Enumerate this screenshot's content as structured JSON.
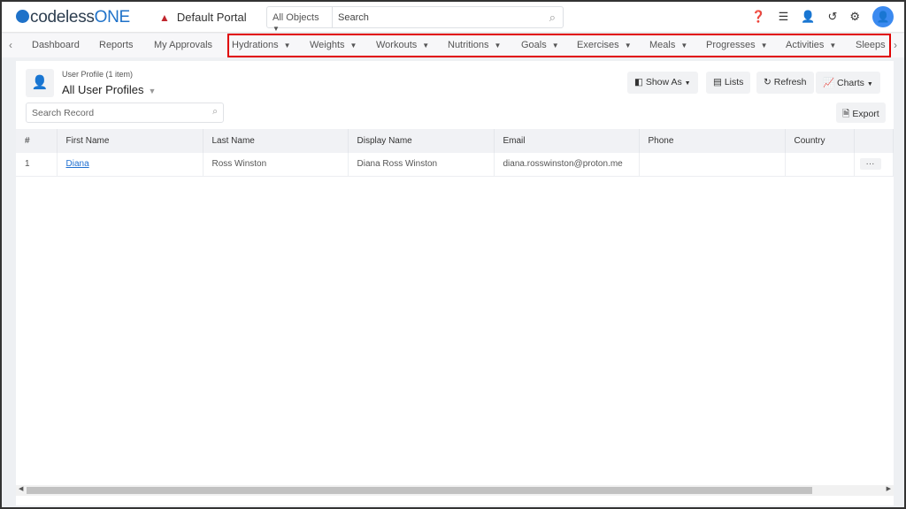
{
  "header": {
    "logo_prefix": "codeless",
    "logo_suffix": "ONE",
    "portal": "Default Portal",
    "search_scope": "All Objects",
    "search_placeholder": "Search",
    "icons": [
      "help-icon",
      "database-icon",
      "add-user-icon",
      "history-icon",
      "gear-icon",
      "user-avatar-icon"
    ]
  },
  "nav": {
    "items": [
      {
        "label": "Dashboard"
      },
      {
        "label": "Reports"
      },
      {
        "label": "My Approvals"
      },
      {
        "label": "Hydrations"
      },
      {
        "label": "Weights"
      },
      {
        "label": "Workouts"
      },
      {
        "label": "Nutritions"
      },
      {
        "label": "Goals"
      },
      {
        "label": "Exercises"
      },
      {
        "label": "Meals"
      },
      {
        "label": "Progresses"
      },
      {
        "label": "Activities"
      },
      {
        "label": "Sleeps"
      }
    ],
    "highlight_color": "#e00000"
  },
  "page": {
    "subtitle": "User Profile (1 item)",
    "title": "All User Profiles",
    "search_placeholder": "Search Record",
    "buttons": {
      "show_as": "Show As",
      "lists": "Lists",
      "refresh": "Refresh",
      "charts": "Charts",
      "export": "Export"
    }
  },
  "table": {
    "headers": [
      "#",
      "First Name",
      "Last Name",
      "Display Name",
      "Email",
      "Phone",
      "Country"
    ],
    "rows": [
      {
        "num": "1",
        "first": "Diana",
        "last": "Ross Winston",
        "display": "Diana Ross Winston",
        "email": "diana.rosswinston@proton.me",
        "phone": "",
        "country": "",
        "more": "···"
      }
    ]
  }
}
